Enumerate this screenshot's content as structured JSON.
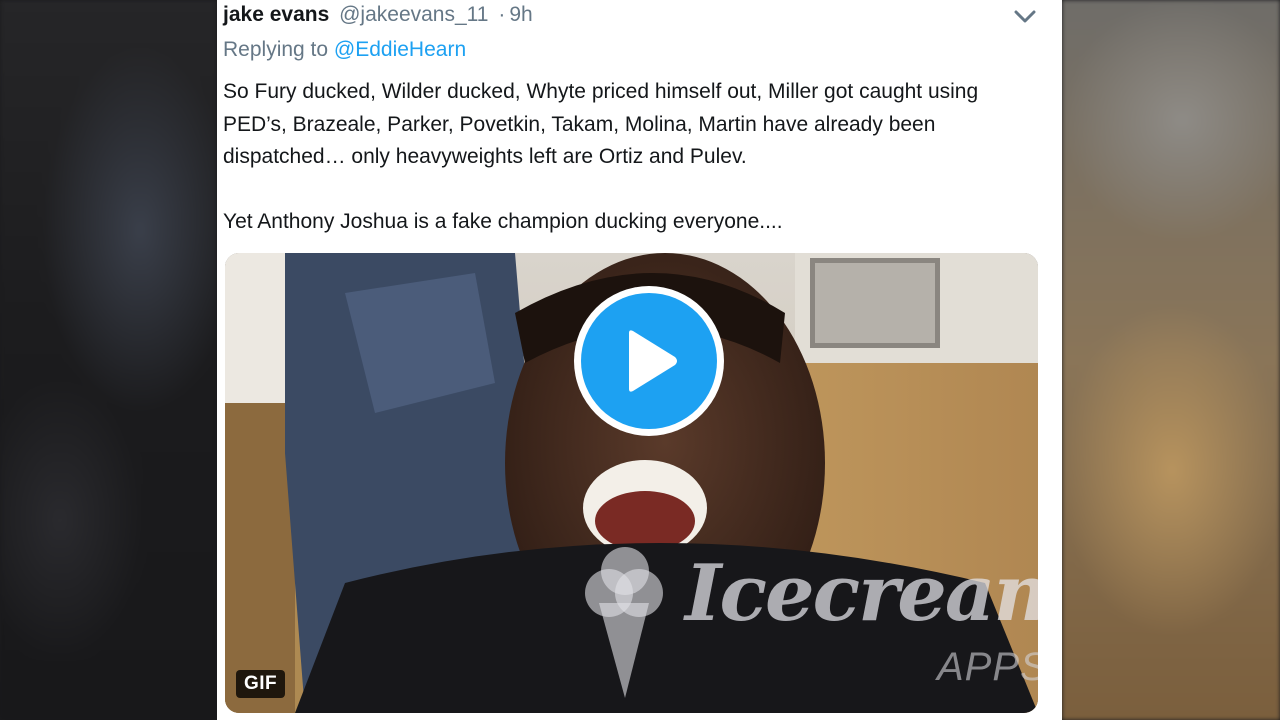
{
  "tweet": {
    "author_name": "jake evans",
    "author_handle": "@jakeevans_11",
    "separator": "·",
    "time": "9h",
    "replying_prefix": "Replying to",
    "replying_handle": "@EddieHearn",
    "paragraph_1": "So Fury ducked, Wilder ducked, Whyte priced himself out, Miller got caught using PED’s, Brazeale, Parker, Povetkin, Takam, Molina, Martin have already been dispatched… only heavyweights left are Ortiz and Pulev.",
    "paragraph_2": "Yet Anthony Joshua is a fake champion ducking everyone....",
    "media_badge": "GIF",
    "watermark_brand": "Icecream",
    "watermark_sub": "APPS"
  },
  "icons": {
    "menu": "chevron-down-icon",
    "play": "play-icon",
    "watermark": "ice-cream-cone-icon"
  },
  "colors": {
    "link": "#1da1f2",
    "play_button": "#1da1f2",
    "muted_text": "#657786",
    "primary_text": "#14171a"
  }
}
